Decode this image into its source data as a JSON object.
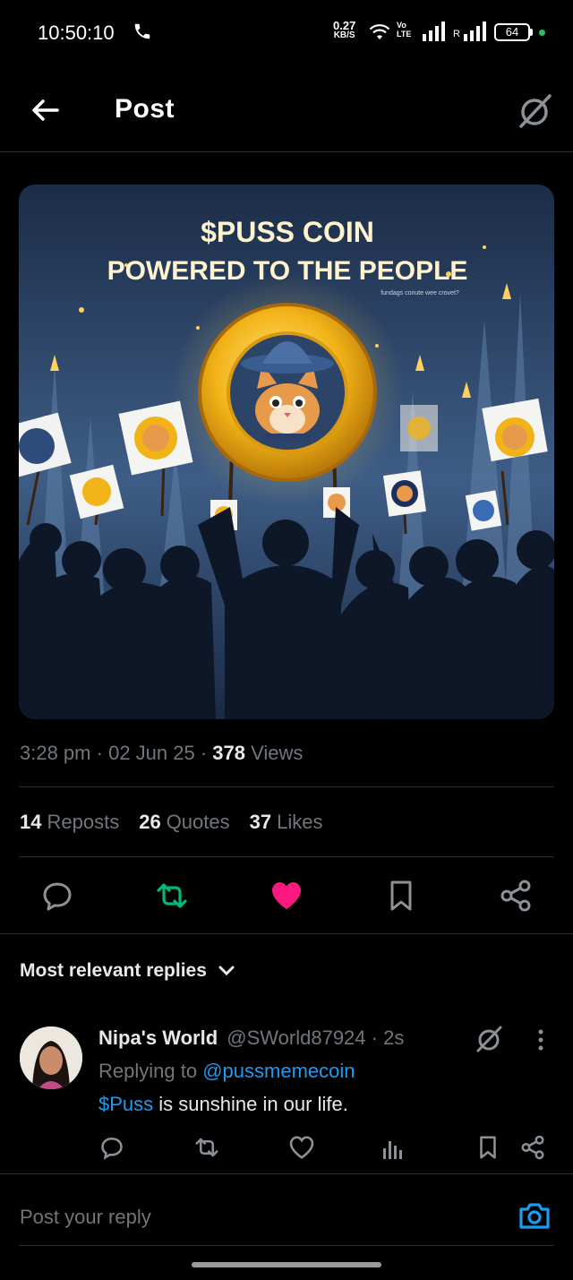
{
  "status_bar": {
    "time": "10:50:10",
    "net_speed_value": "0.27",
    "net_speed_unit": "KB/S",
    "volte_top": "Vo",
    "volte_bottom": "LTE",
    "sim2_label": "R",
    "battery": "64",
    "icons": [
      "phone-icon",
      "wifi-icon",
      "signal-icon",
      "battery-icon"
    ]
  },
  "header": {
    "title": "Post",
    "back_icon": "arrow-left-icon",
    "grok_icon": "grok-icon"
  },
  "post": {
    "image": {
      "headline_line1": "$PUSS COIN",
      "headline_line2": "POWERED TO THE PEOPLE",
      "small_caption": "fundags conute wee crovet?"
    },
    "meta": {
      "time": "3:28 pm",
      "date": "02 Jun 25",
      "views_count": "378",
      "views_label": "Views"
    },
    "stats": [
      {
        "count": "14",
        "label": "Reposts"
      },
      {
        "count": "26",
        "label": "Quotes"
      },
      {
        "count": "37",
        "label": "Likes"
      }
    ],
    "actions": [
      "reply-icon",
      "repost-icon",
      "like-icon",
      "bookmark-icon",
      "share-icon"
    ],
    "colors": {
      "repost_active": "#00ba7c",
      "like_active": "#f91880",
      "link": "#1d9bf0"
    }
  },
  "replies": {
    "sort_label": "Most relevant replies",
    "items": [
      {
        "display_name": "Nipa's World",
        "handle": "@SWorld87924",
        "time": "2s",
        "replying_to_label": "Replying to",
        "replying_to_handle": "@pussmemecoin",
        "text_link": "$Puss",
        "text_rest": " is sunshine in our life."
      }
    ]
  },
  "composer": {
    "placeholder": "Post your reply",
    "camera_icon": "camera-icon"
  }
}
